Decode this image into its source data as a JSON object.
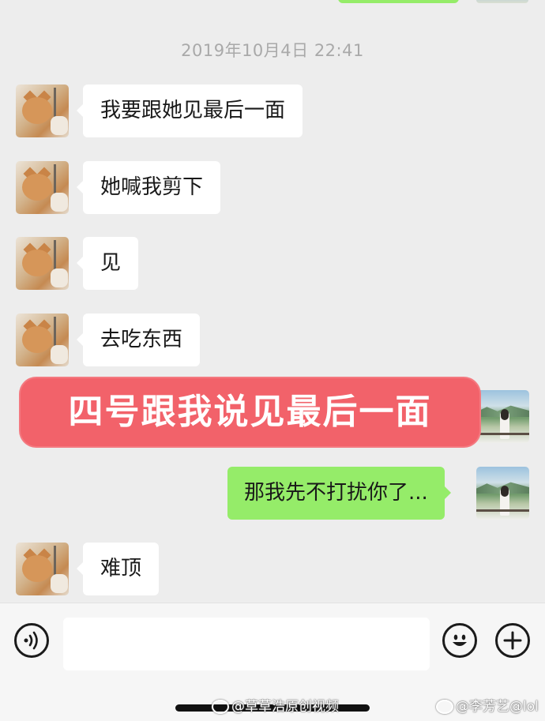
{
  "timestamp": "2019年10月4日 22:41",
  "messages": [
    {
      "sender": "other",
      "text": "我要跟她见最后一面"
    },
    {
      "sender": "other",
      "text": "她喊我剪下"
    },
    {
      "sender": "other",
      "text": "见"
    },
    {
      "sender": "other",
      "text": "去吃东西"
    },
    {
      "sender": "me",
      "text": "那我先不打扰你了..."
    },
    {
      "sender": "other",
      "text": "难顶"
    }
  ],
  "banner": {
    "text": "四号跟我说见最后一面",
    "color": "#f2626a"
  },
  "avatars": {
    "other": "cat-avatar",
    "me": "girl-landscape-avatar"
  },
  "input_bar": {
    "voice_icon": "voice-icon",
    "emoji_icon": "emoji-icon",
    "plus_icon": "plus-icon",
    "input_value": ""
  },
  "watermarks": {
    "left": "@草草浩原创视频",
    "right": "@李芳艺@lol"
  },
  "colors": {
    "background": "#ededed",
    "my_bubble": "#95ec69",
    "other_bubble": "#ffffff",
    "timestamp": "#a9a9a9"
  }
}
